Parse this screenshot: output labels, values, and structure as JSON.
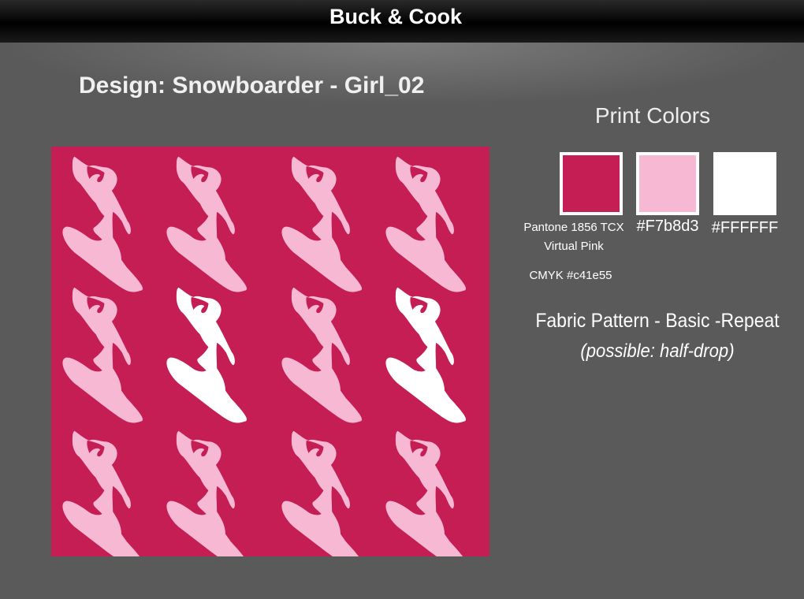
{
  "header": {
    "brand": "Buck & Cook"
  },
  "design": {
    "title": "Design: Snowboarder - Girl_02"
  },
  "fabric": {
    "background_color": "#c41e55",
    "rows": 3,
    "cols": 4,
    "motif": "snowboarder-girl-silhouette",
    "white_motif_positions": [
      [
        1,
        1
      ],
      [
        1,
        3
      ]
    ]
  },
  "print_colors": {
    "title": "Print Colors",
    "swatches": [
      {
        "color": "#c41e55",
        "label_line1": "Pantone 1856 TCX",
        "label_line2": "Virtual Pink",
        "label_line3": "CMYK #c41e55"
      },
      {
        "color": "#f7b8d3",
        "label_line1": "#F7b8d3"
      },
      {
        "color": "#ffffff",
        "label_line1": "#FFFFFF"
      }
    ]
  },
  "pattern": {
    "line1": "Fabric Pattern - Basic -Repeat",
    "line2": "(possible: half-drop)"
  }
}
